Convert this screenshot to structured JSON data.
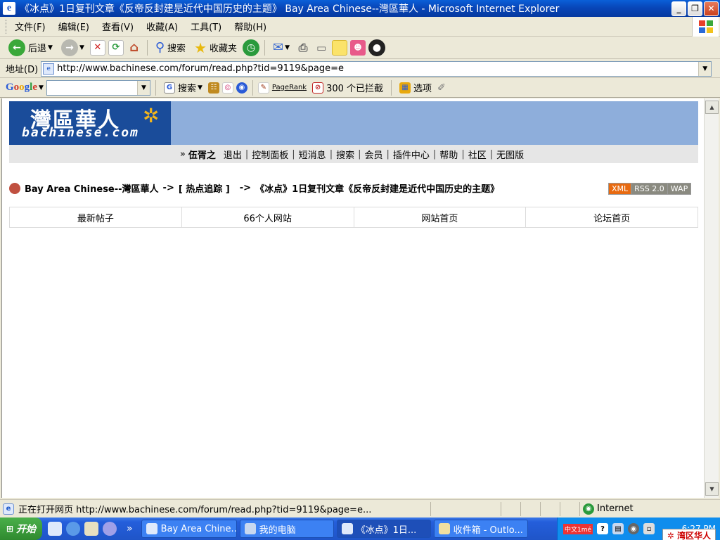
{
  "window": {
    "title": "《冰点》1日复刊文章《反帝反封建是近代中国历史的主题》 Bay Area Chinese--灣區華人 - Microsoft Internet Explorer"
  },
  "menu": [
    "文件(F)",
    "编辑(E)",
    "查看(V)",
    "收藏(A)",
    "工具(T)",
    "帮助(H)"
  ],
  "toolbar": {
    "back": "后退",
    "search": "搜索",
    "favorites": "收藏夹"
  },
  "address": {
    "label": "地址(D)",
    "url": "http://www.bachinese.com/forum/read.php?tid=9119&page=e"
  },
  "google_bar": {
    "logo_parts": [
      "G",
      "o",
      "o",
      "g",
      "l",
      "e"
    ],
    "search": "搜索",
    "pagerank": "PageRank",
    "blocked": "300 个已拦截",
    "options": "选项"
  },
  "page": {
    "logo_cn": "灣區華人",
    "logo_en": "bachinese.com",
    "logo_star": "✲",
    "nav": {
      "prefix": "»",
      "user": "伍胥之",
      "links": [
        "退出",
        "控制面板",
        "短消息",
        "搜索",
        "会员",
        "插件中心",
        "帮助",
        "社区",
        "无图版"
      ]
    },
    "breadcrumb": {
      "site": "Bay Area Chinese--灣區華人",
      "arrow1": "->",
      "section": "[ 热点追踪 ]",
      "arrow2": "->",
      "thread": "《冰点》1日复刊文章《反帝反封建是近代中国历史的主题》"
    },
    "feeds": [
      "XML",
      "RSS 2.0",
      "WAP"
    ],
    "quicknav": [
      "最新帖子",
      "66个人网站",
      "网站首页",
      "论坛首页"
    ]
  },
  "status": {
    "text": "正在打开网页 http://www.bachinese.com/forum/read.php?tid=9119&page=e...",
    "zone": "Internet"
  },
  "taskbar": {
    "start": "开始",
    "more": "»",
    "tasks": [
      "Bay Area Chine...",
      "我的电脑",
      "《冰点》1日...",
      "收件箱 - Outlo..."
    ],
    "active_index": 2,
    "ime": "中文1mé",
    "clock": "6:27 PM",
    "badge": "✲ 湾区华人"
  }
}
